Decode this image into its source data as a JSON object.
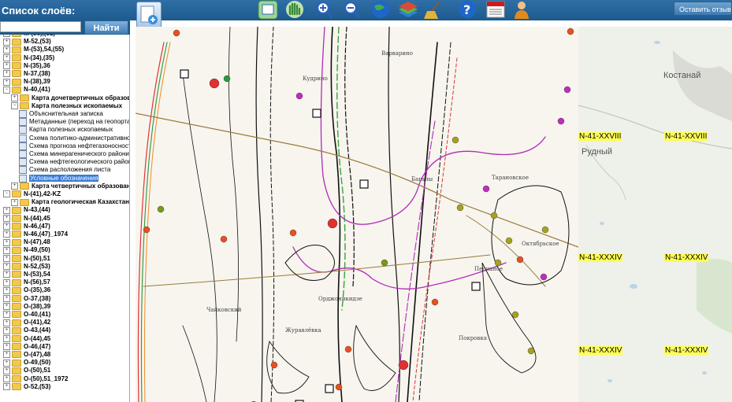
{
  "app": {
    "layers_title": "Список слоёв:",
    "feedback_button": "Оставить отзыв",
    "search_placeholder": "",
    "find_button": "Найти"
  },
  "tree": [
    {
      "label": "M-(50),(51)",
      "type": "folder",
      "exp": "+"
    },
    {
      "label": "M-52,(53)",
      "type": "folder",
      "exp": "+"
    },
    {
      "label": "M-(53),54,(55)",
      "type": "folder",
      "exp": "+"
    },
    {
      "label": "N-(34),(35)",
      "type": "folder",
      "exp": "+"
    },
    {
      "label": "N-(35),36",
      "type": "folder",
      "exp": "+"
    },
    {
      "label": "N-37,(38)",
      "type": "folder",
      "exp": "+"
    },
    {
      "label": "N-(38),39",
      "type": "folder",
      "exp": "+"
    },
    {
      "label": "N-40,(41)",
      "type": "folder",
      "exp": "−"
    },
    {
      "label": "Карта дочетвертичных образований",
      "type": "folder",
      "exp": "+",
      "indent": 1
    },
    {
      "label": "Карта полезных ископаемых",
      "type": "folder",
      "exp": "−",
      "indent": 1
    },
    {
      "label": "Объяснительная записка",
      "type": "doc",
      "indent": 2
    },
    {
      "label": "Метаданные (переход на геопортал)",
      "type": "doc",
      "indent": 2
    },
    {
      "label": "Карта полезных ископаемых",
      "type": "doc",
      "indent": 2
    },
    {
      "label": "Схема политико-административного",
      "type": "doc",
      "indent": 2
    },
    {
      "label": "Схема прогноза нефтегазоносности",
      "type": "doc",
      "indent": 2
    },
    {
      "label": "Схема минерагенического районир.",
      "type": "doc",
      "indent": 2
    },
    {
      "label": "Схема нефтегеологического районир.",
      "type": "doc",
      "indent": 2
    },
    {
      "label": "Схема расположения листа",
      "type": "doc",
      "indent": 2
    },
    {
      "label": "Условные обозначения",
      "type": "doc",
      "indent": 2,
      "selected": true
    },
    {
      "label": "Карта четвертичных образований",
      "type": "folder",
      "exp": "+",
      "indent": 1
    },
    {
      "label": "N-(41),42-KZ",
      "type": "folder",
      "exp": "−"
    },
    {
      "label": "Карта геологическая Казахстана",
      "type": "folder",
      "exp": "+",
      "indent": 1
    },
    {
      "label": "N-43,(44)",
      "type": "folder",
      "exp": "+"
    },
    {
      "label": "N-(44),45",
      "type": "folder",
      "exp": "+"
    },
    {
      "label": "N-46,(47)",
      "type": "folder",
      "exp": "+"
    },
    {
      "label": "N-46,(47)_1974",
      "type": "folder",
      "exp": "+"
    },
    {
      "label": "N-(47),48",
      "type": "folder",
      "exp": "+"
    },
    {
      "label": "N-49,(50)",
      "type": "folder",
      "exp": "+"
    },
    {
      "label": "N-(50),51",
      "type": "folder",
      "exp": "+"
    },
    {
      "label": "N-52,(53)",
      "type": "folder",
      "exp": "+"
    },
    {
      "label": "N-(53),54",
      "type": "folder",
      "exp": "+"
    },
    {
      "label": "N-(56),57",
      "type": "folder",
      "exp": "+"
    },
    {
      "label": "O-(35),36",
      "type": "folder",
      "exp": "+"
    },
    {
      "label": "O-37,(38)",
      "type": "folder",
      "exp": "+"
    },
    {
      "label": "O-(38),39",
      "type": "folder",
      "exp": "+"
    },
    {
      "label": "O-40,(41)",
      "type": "folder",
      "exp": "+"
    },
    {
      "label": "O-(41),42",
      "type": "folder",
      "exp": "+"
    },
    {
      "label": "O-43,(44)",
      "type": "folder",
      "exp": "+"
    },
    {
      "label": "O-(44),45",
      "type": "folder",
      "exp": "+"
    },
    {
      "label": "O-46,(47)",
      "type": "folder",
      "exp": "+"
    },
    {
      "label": "O-(47),48",
      "type": "folder",
      "exp": "+"
    },
    {
      "label": "O-49,(50)",
      "type": "folder",
      "exp": "+"
    },
    {
      "label": "O-(50),51",
      "type": "folder",
      "exp": "+"
    },
    {
      "label": "O-(50),51_1972",
      "type": "folder",
      "exp": "+"
    },
    {
      "label": "O-52,(53)",
      "type": "folder",
      "exp": "+"
    }
  ],
  "map": {
    "sheets": [
      "N-41-XXVIII",
      "N-41-XXVIII",
      "N-41-XXXIV",
      "N-41-XXXIV",
      "N-41-XXXIV",
      "N-41-XXXIV"
    ],
    "cities": [
      "Костанай",
      "Рудный"
    ],
    "places": [
      "Варварино",
      "Кудрино",
      "Багалы",
      "Тарановское",
      "Октябрьское",
      "Песчаное",
      "Покровка",
      "Чайковский",
      "Орджоникидзе",
      "Журавлёвка"
    ]
  },
  "colors": {
    "topbar": "#1d5a8e",
    "selection": "#3a7bd5",
    "sheet_label_bg": "#ffff55"
  }
}
